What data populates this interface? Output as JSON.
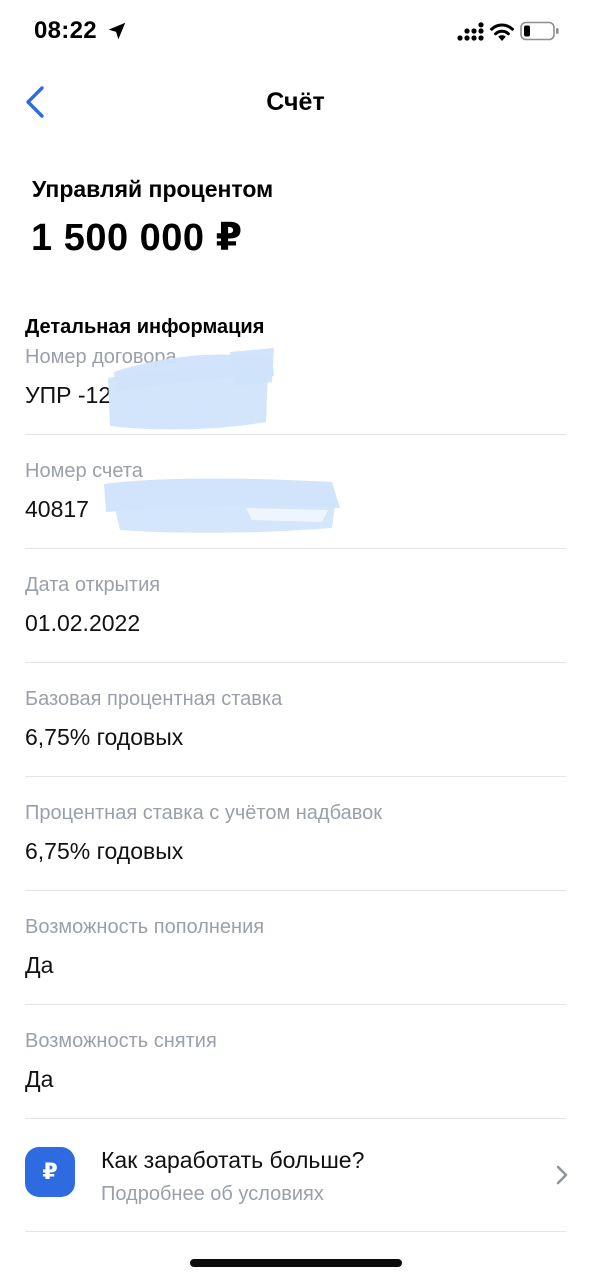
{
  "status_bar": {
    "time": "08:22"
  },
  "nav": {
    "title": "Счёт"
  },
  "product": {
    "title": "Управляй процентом",
    "amount": "1 500 000 ₽"
  },
  "details": {
    "heading": "Детальная информация",
    "fields": [
      {
        "label": "Номер договора",
        "value": "УПР -12"
      },
      {
        "label": "Номер счета",
        "value": "40817"
      },
      {
        "label": "Дата открытия",
        "value": "01.02.2022"
      },
      {
        "label": "Базовая процентная ставка",
        "value": "6,75% годовых"
      },
      {
        "label": "Процентная ставка с учётом надбавок",
        "value": "6,75% годовых"
      },
      {
        "label": "Возможность пополнения",
        "value": "Да"
      },
      {
        "label": "Возможность снятия",
        "value": "Да"
      }
    ]
  },
  "promo": {
    "icon_glyph": "₽",
    "title": "Как заработать больше?",
    "subtitle": "Подробнее об условиях"
  },
  "colors": {
    "accent": "#2f6be0",
    "label_gray": "#9aa0aa",
    "divider": "#e3e5e8",
    "redaction": "#cfe3fb"
  },
  "icons": {
    "back": "chevron-left-icon",
    "location": "location-arrow-icon",
    "signal": "cellular-signal-icon",
    "wifi": "wifi-icon",
    "battery": "battery-icon",
    "promo": "ruble-icon",
    "promo_chevron": "chevron-right-icon"
  }
}
